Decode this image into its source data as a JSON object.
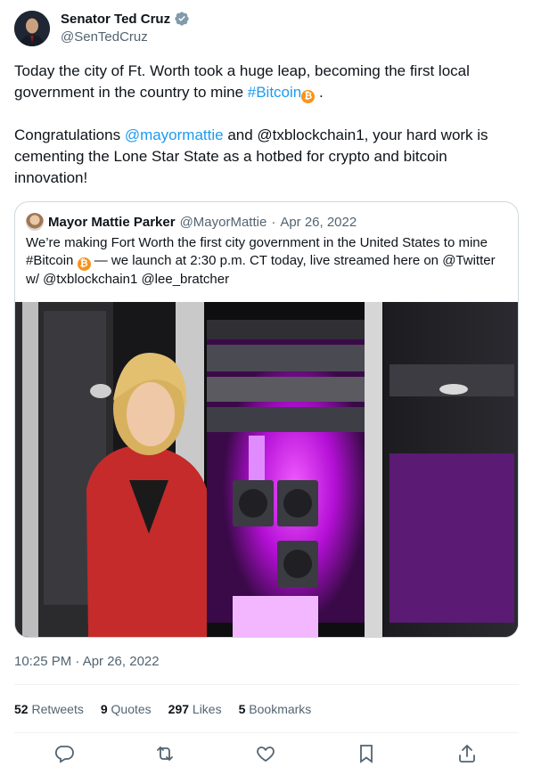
{
  "author": {
    "name": "Senator Ted Cruz",
    "handle": "@SenTedCruz"
  },
  "tweet": {
    "line1_text": "Today the city of Ft. Worth took a huge leap, becoming the first local government in the country to mine ",
    "line1_hashtag": "#Bitcoin",
    "line1_end": " .",
    "p2_start": "Congratulations ",
    "p2_mention": "@mayormattie",
    "p2_rest": " and @txblockchain1, your hard work is cementing the Lone Star State as a hotbed for crypto and bitcoin innovation!"
  },
  "quoted": {
    "name": "Mayor Mattie Parker",
    "handle": "@MayorMattie",
    "sep": "·",
    "date": "Apr 26, 2022",
    "text_a": "We’re making Fort Worth the first city government in the United States to mine #Bitcoin ",
    "text_b": " — we launch at 2:30 p.m. CT today, live streamed here on @Twitter w/ @txblockchain1 @lee_bratcher"
  },
  "meta": {
    "timestamp": "10:25 PM · Apr 26, 2022"
  },
  "stats": {
    "retweets_count": "52",
    "retweets_label": "Retweets",
    "quotes_count": "9",
    "quotes_label": "Quotes",
    "likes_count": "297",
    "likes_label": "Likes",
    "bookmarks_count": "5",
    "bookmarks_label": "Bookmarks"
  },
  "emoji": {
    "bitcoin_glyph": "₿"
  },
  "colors": {
    "link": "#1d9bf0",
    "verified": "#829aab",
    "bitcoin": "#f7931a",
    "server_glow": "#d21ef0"
  },
  "icons": [
    "reply-icon",
    "retweet-icon",
    "like-icon",
    "bookmark-icon",
    "share-icon",
    "verified-icon"
  ]
}
